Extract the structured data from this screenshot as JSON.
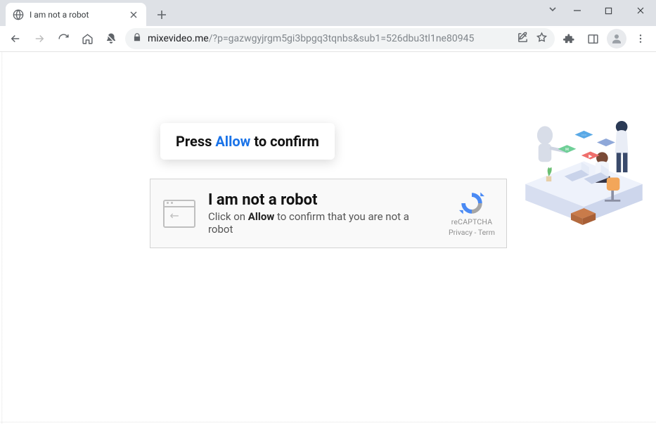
{
  "tab": {
    "title": "I am not a robot"
  },
  "url": {
    "host": "mixevideo.me",
    "path": "/?p=gazwgyjrgm5gi3bpgq3tqnbs&sub1=526dbu3tl1ne80945"
  },
  "press_bubble": {
    "prefix": "Press ",
    "highlight": "Allow",
    "suffix": " to confirm"
  },
  "captcha": {
    "heading": "I am not a robot",
    "sub_prefix": "Click on ",
    "sub_bold": "Allow",
    "sub_suffix": " to confirm that you are not a robot",
    "brand": "reCAPTCHA",
    "links": "Privacy - Term"
  }
}
